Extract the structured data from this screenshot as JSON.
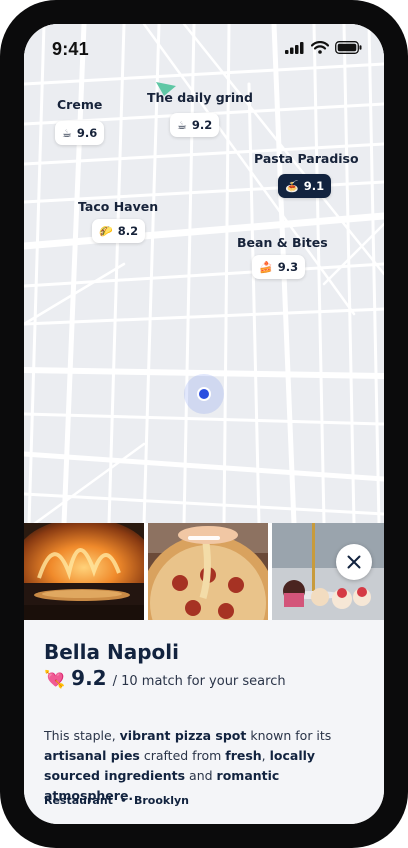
{
  "status_bar": {
    "time": "9:41"
  },
  "map": {
    "places": [
      {
        "name": "Creme",
        "icon": "coffee-icon",
        "emoji": "☕",
        "score": "9.6"
      },
      {
        "name": "The daily grind",
        "icon": "coffee-icon",
        "emoji": "☕",
        "score": "9.2"
      },
      {
        "name": "Pasta Paradiso",
        "icon": "pasta-icon",
        "emoji": "🍝",
        "score": "9.1",
        "selected": true
      },
      {
        "name": "Taco Haven",
        "icon": "taco-icon",
        "emoji": "🌮",
        "score": "8.2"
      },
      {
        "name": "Bean & Bites",
        "icon": "cake-icon",
        "emoji": "🍰",
        "score": "9.3"
      }
    ]
  },
  "photos": [
    {
      "icon": "pizza-oven-photo"
    },
    {
      "icon": "pizza-slice-photo"
    },
    {
      "icon": "desserts-photo"
    }
  ],
  "card": {
    "title": "Bella Napoli",
    "heart_emoji": "💘",
    "score": "9.2",
    "match_text": "/ 10 match for your search",
    "description": [
      {
        "text": "This staple, ",
        "bold": false
      },
      {
        "text": "vibrant pizza spot",
        "bold": true
      },
      {
        "text": " known for its ",
        "bold": false
      },
      {
        "text": "artisanal pies",
        "bold": true
      },
      {
        "text": " crafted from ",
        "bold": false
      },
      {
        "text": "fresh",
        "bold": true
      },
      {
        "text": ", ",
        "bold": false
      },
      {
        "text": "locally sourced ingredients",
        "bold": true
      },
      {
        "text": " and ",
        "bold": false
      },
      {
        "text": "romantic atmosphere.",
        "bold": true
      }
    ],
    "tags": [
      "Restaurant",
      "Brooklyn"
    ],
    "tag_separator": "•"
  },
  "colors": {
    "accent_navy": "#12233f",
    "user_dot": "#2b4fe0",
    "heart": "#e0427a"
  }
}
